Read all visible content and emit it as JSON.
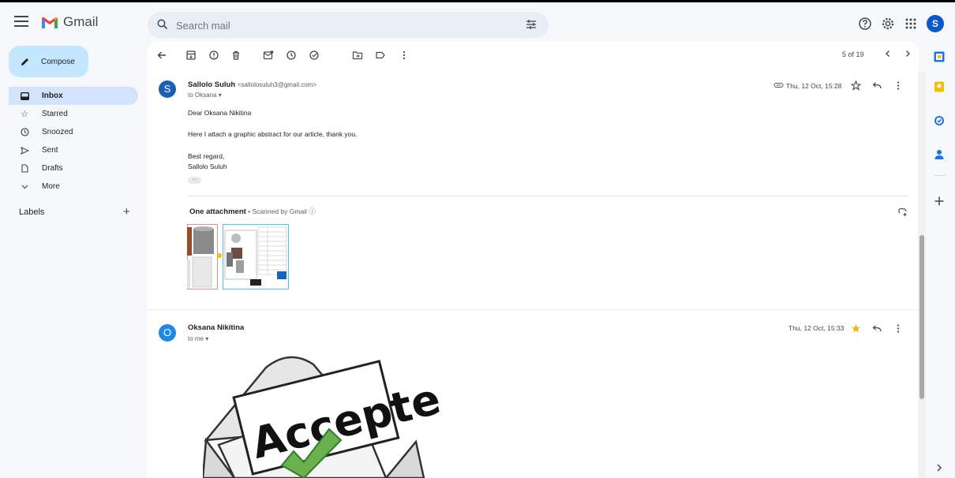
{
  "app": {
    "name": "Gmail"
  },
  "search": {
    "placeholder": "Search mail"
  },
  "user": {
    "avatar_letter": "S"
  },
  "sidebar": {
    "compose_label": "Compose",
    "items": [
      {
        "label": "Inbox",
        "icon": "inbox-icon",
        "active": true
      },
      {
        "label": "Starred",
        "icon": "star-icon"
      },
      {
        "label": "Snoozed",
        "icon": "clock-icon"
      },
      {
        "label": "Sent",
        "icon": "send-icon"
      },
      {
        "label": "Drafts",
        "icon": "draft-icon"
      },
      {
        "label": "More",
        "icon": "chevron-down-icon"
      }
    ],
    "labels_heading": "Labels"
  },
  "pager": {
    "text": "5 of 19"
  },
  "messages": [
    {
      "avatar_letter": "S",
      "avatar_color": "#1a5fb4",
      "sender_name": "Sallolo Suluh",
      "sender_email": "<sallolosuluh3@gmail.com>",
      "to": "to Oksana",
      "date": "Thu, 12 Oct, 15:28",
      "starred": false,
      "body": [
        "Dear Oksana Nikitina",
        "Here I attach a graphic abstract for our article, thank you.",
        "Best regard,",
        "Sallolo Suluh"
      ],
      "attachment_title": "One attachment",
      "attachment_sub": " • Scanned by Gmail ⓘ"
    },
    {
      "avatar_letter": "O",
      "avatar_color": "#1e88e5",
      "sender_name": "Oksana Nikitina",
      "to": "to me",
      "date": "Thu, 12 Oct, 15:33",
      "starred": true,
      "image_text": "Accepted !"
    }
  ],
  "colors": {
    "accent": "#0b57d0",
    "compose_bg": "#c2e7ff",
    "active_nav": "#d3e3fd",
    "star": "#f4b400"
  }
}
